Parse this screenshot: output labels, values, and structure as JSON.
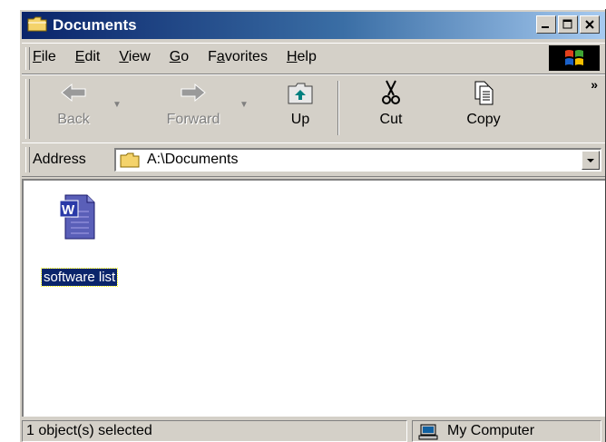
{
  "window": {
    "title": "Documents",
    "title_icon": "folder-icon",
    "controls": [
      "minimize",
      "maximize",
      "close"
    ]
  },
  "menu": [
    {
      "label": "File",
      "accel": "F"
    },
    {
      "label": "Edit",
      "accel": "E"
    },
    {
      "label": "View",
      "accel": "V"
    },
    {
      "label": "Go",
      "accel": "G"
    },
    {
      "label": "Favorites",
      "accel": "a"
    },
    {
      "label": "Help",
      "accel": "H"
    }
  ],
  "toolbar": {
    "back_label": "Back",
    "forward_label": "Forward",
    "up_label": "Up",
    "cut_label": "Cut",
    "copy_label": "Copy",
    "chevron": "»"
  },
  "address": {
    "label": "Address",
    "value": "A:\\Documents"
  },
  "files": [
    {
      "name": "software list",
      "icon": "word-document-icon",
      "selected": true
    }
  ],
  "status": {
    "text": "1 object(s) selected",
    "zone": "My Computer"
  },
  "colors": {
    "title_start": "#0a246a",
    "title_end": "#a6caf0",
    "selection": "#0a246a",
    "face": "#d4d0c8"
  }
}
